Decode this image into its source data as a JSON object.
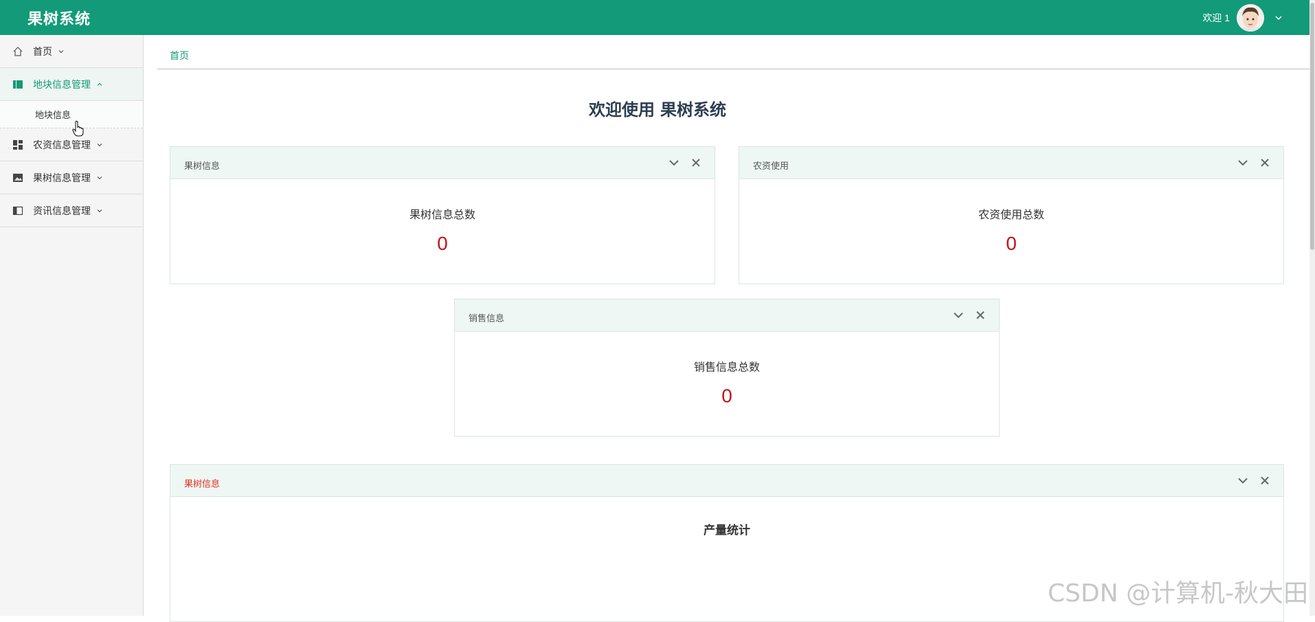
{
  "app": {
    "title": "果树系统"
  },
  "user": {
    "greeting": "欢迎 1"
  },
  "sidebar": {
    "items": [
      {
        "label": "首页"
      },
      {
        "label": "地块信息管理",
        "sub": [
          {
            "label": "地块信息"
          }
        ]
      },
      {
        "label": "农资信息管理"
      },
      {
        "label": "果树信息管理"
      },
      {
        "label": "资讯信息管理"
      }
    ]
  },
  "breadcrumb": {
    "home": "首页"
  },
  "welcome": {
    "prefix": "欢迎使用",
    "system": "果树系统"
  },
  "panels": [
    {
      "title": "果树信息",
      "label": "果树信息总数",
      "value": "0"
    },
    {
      "title": "农资使用",
      "label": "农资使用总数",
      "value": "0"
    },
    {
      "title": "销售信息",
      "label": "销售信息总数",
      "value": "0"
    },
    {
      "title": "果树信息",
      "chart_title": "产量统计"
    }
  ],
  "watermark": "CSDN @计算机-秋大田",
  "colors": {
    "primary": "#139a78",
    "value_red": "#c0141b",
    "panel_head": "#eef7f4"
  }
}
